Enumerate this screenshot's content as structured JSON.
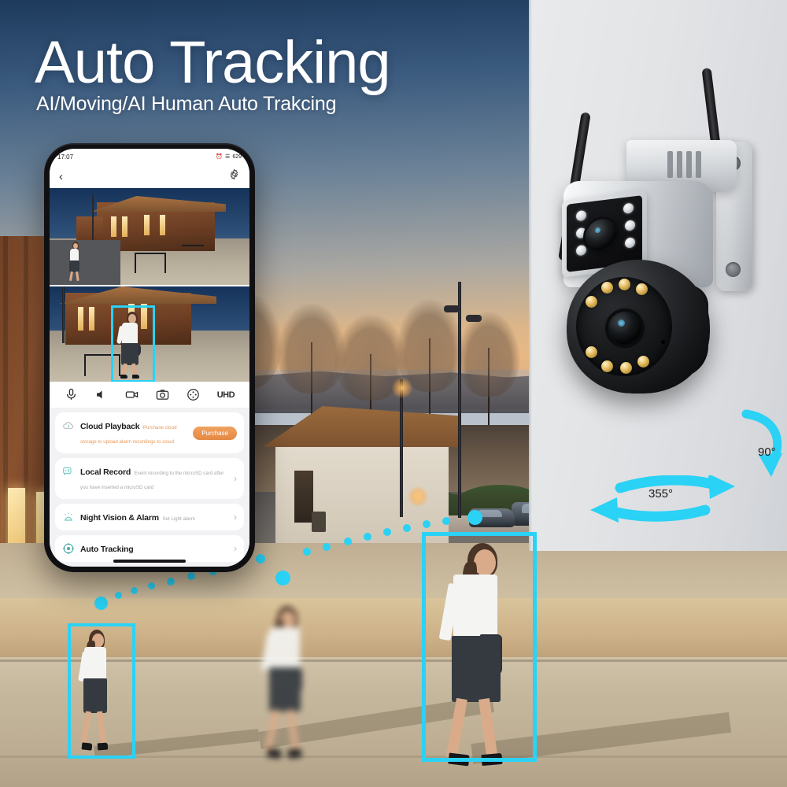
{
  "hero": {
    "title": "Auto Tracking",
    "subtitle": "AI/Moving/AI Human Auto Trakcing"
  },
  "phone": {
    "status_bar": {
      "time": "17:07",
      "icons": [
        "alarm-icon",
        "signal-icon",
        "wifi-icon",
        "battery-icon"
      ],
      "battery": "629"
    },
    "nav": {
      "back_icon": "chevron-left-icon",
      "settings_icon": "gear-icon"
    },
    "live_view": {
      "top_label": "wide-angle-camera-view",
      "bottom_label": "zoom-camera-view",
      "tracking_box_color": "#2ad2f5"
    },
    "toolbar": [
      {
        "icon": "microphone-icon",
        "label": ""
      },
      {
        "icon": "speaker-icon",
        "label": ""
      },
      {
        "icon": "video-record-icon",
        "label": ""
      },
      {
        "icon": "snapshot-camera-icon",
        "label": ""
      },
      {
        "icon": "ptz-direction-icon",
        "label": ""
      },
      {
        "icon": "quality-icon",
        "label": "UHD"
      }
    ],
    "menu": [
      {
        "icon": "cloud-icon",
        "title": "Cloud Playback",
        "subtitle": "Purchase cloud storage to upload alarm recordings to cloud",
        "subtitle_color": "#e89a5c",
        "action_label": "Purchase",
        "has_chevron": false
      },
      {
        "icon": "sd-record-icon",
        "title": "Local Record",
        "subtitle": "Event recording to the microSD card after you have inserted a microSD card",
        "subtitle_color": "#a8a8ae",
        "action_label": "",
        "has_chevron": true
      },
      {
        "icon": "night-alarm-icon",
        "title": "Night Vision & Alarm",
        "subtitle": "Set Light alarm",
        "subtitle_color": "#a8a8ae",
        "action_label": "",
        "has_chevron": true
      },
      {
        "icon": "auto-tracking-icon",
        "title": "Auto Tracking",
        "subtitle": "",
        "subtitle_color": "#a8a8ae",
        "action_label": "",
        "has_chevron": true
      }
    ]
  },
  "camera": {
    "name": "dual-lens-ptz-wifi-camera",
    "antennas": 2,
    "upper_leds": 6,
    "lower_leds": 8,
    "lens_count": 2
  },
  "rotation": {
    "tilt_label": "90°",
    "pan_label": "355°",
    "arrow_color": "#2ad2f5"
  },
  "colors": {
    "accent_cyan": "#2ad2f5",
    "accent_orange": "#e58842",
    "text_dark": "#1d1d20"
  }
}
